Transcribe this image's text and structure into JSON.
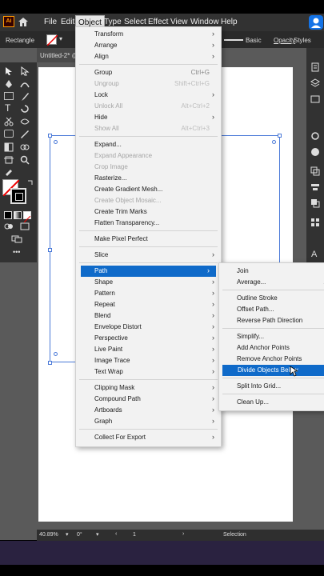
{
  "app": {
    "logo": "Ai",
    "home_icon": "home-icon"
  },
  "menubar": {
    "items": [
      "File",
      "Edit",
      "Object",
      "Type",
      "Select",
      "Effect",
      "View",
      "Window",
      "Help"
    ]
  },
  "control_bar": {
    "tool_label": "Rectangle",
    "stroke_style": "Basic",
    "opacity_label": "Opacity",
    "style_label": "Styles"
  },
  "document": {
    "tab_title": "Untitled-2* @"
  },
  "status_bar": {
    "zoom": "40.89%",
    "rotation": "0°",
    "artboard_number": "1",
    "current_tool": "Selection"
  },
  "object_menu": {
    "items": [
      {
        "label": "Transform",
        "submenu": true
      },
      {
        "label": "Arrange",
        "submenu": true
      },
      {
        "label": "Align",
        "submenu": true
      },
      {
        "label": "Group",
        "shortcut": "Ctrl+G"
      },
      {
        "label": "Ungroup",
        "shortcut": "Shift+Ctrl+G",
        "disabled": true
      },
      {
        "label": "Lock",
        "submenu": true
      },
      {
        "label": "Unlock All",
        "shortcut": "Alt+Ctrl+2",
        "disabled": true
      },
      {
        "label": "Hide",
        "submenu": true
      },
      {
        "label": "Show All",
        "shortcut": "Alt+Ctrl+3",
        "disabled": true
      },
      {
        "label": "Expand..."
      },
      {
        "label": "Expand Appearance",
        "disabled": true
      },
      {
        "label": "Crop Image",
        "disabled": true
      },
      {
        "label": "Rasterize..."
      },
      {
        "label": "Create Gradient Mesh..."
      },
      {
        "label": "Create Object Mosaic...",
        "disabled": true
      },
      {
        "label": "Create Trim Marks"
      },
      {
        "label": "Flatten Transparency..."
      },
      {
        "label": "Make Pixel Perfect"
      },
      {
        "label": "Slice",
        "submenu": true
      },
      {
        "label": "Path",
        "submenu": true,
        "highlighted": true
      },
      {
        "label": "Shape",
        "submenu": true
      },
      {
        "label": "Pattern",
        "submenu": true
      },
      {
        "label": "Repeat",
        "submenu": true
      },
      {
        "label": "Blend",
        "submenu": true
      },
      {
        "label": "Envelope Distort",
        "submenu": true
      },
      {
        "label": "Perspective",
        "submenu": true
      },
      {
        "label": "Live Paint",
        "submenu": true
      },
      {
        "label": "Image Trace",
        "submenu": true
      },
      {
        "label": "Text Wrap",
        "submenu": true
      },
      {
        "label": "Clipping Mask",
        "submenu": true
      },
      {
        "label": "Compound Path",
        "submenu": true
      },
      {
        "label": "Artboards",
        "submenu": true
      },
      {
        "label": "Graph",
        "submenu": true
      },
      {
        "label": "Collect For Export",
        "submenu": true
      }
    ]
  },
  "path_submenu": {
    "items": [
      {
        "label": "Join"
      },
      {
        "label": "Average...",
        "shortcut": "Alt"
      },
      {
        "label": "Outline Stroke"
      },
      {
        "label": "Offset Path..."
      },
      {
        "label": "Reverse Path Direction"
      },
      {
        "label": "Simplify..."
      },
      {
        "label": "Add Anchor Points"
      },
      {
        "label": "Remove Anchor Points"
      },
      {
        "label": "Divide Objects Below",
        "highlighted": true
      },
      {
        "label": "Split Into Grid..."
      },
      {
        "label": "Clean Up..."
      }
    ]
  },
  "colors": {
    "accent": "#0f6ac9",
    "menubar": "#323232",
    "workspace": "#5a5a5a"
  }
}
